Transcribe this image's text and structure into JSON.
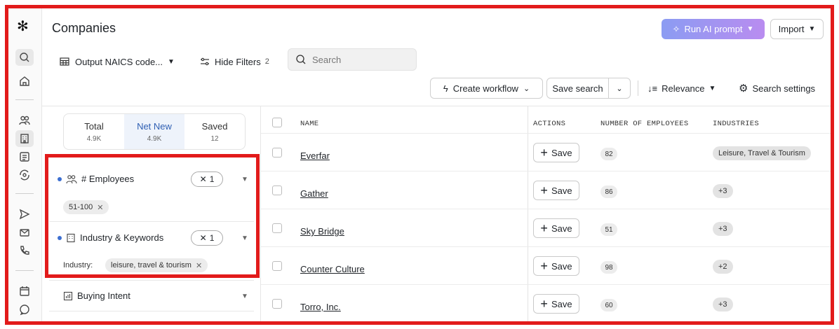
{
  "header": {
    "title": "Companies",
    "ai_button": "Run AI prompt",
    "import_button": "Import"
  },
  "toolbar": {
    "output_label": "Output NAICS code...",
    "hide_filters_label": "Hide Filters",
    "hide_filters_count": "2",
    "search_placeholder": "Search",
    "create_workflow": "Create workflow",
    "save_search": "Save search",
    "relevance": "Relevance",
    "search_settings": "Search settings"
  },
  "segments": [
    {
      "label": "Total",
      "count": "4.9K"
    },
    {
      "label": "Net New",
      "count": "4.9K"
    },
    {
      "label": "Saved",
      "count": "12"
    }
  ],
  "filters": {
    "employees": {
      "title": "# Employees",
      "count": "1",
      "chip": "51-100"
    },
    "industry": {
      "title": "Industry & Keywords",
      "count": "1",
      "sub_label": "Industry:",
      "chip": "leisure, travel & tourism"
    },
    "buying": {
      "title": "Buying Intent"
    }
  },
  "table": {
    "headers": {
      "name": "NAME",
      "actions": "ACTIONS",
      "employees": "NUMBER OF EMPLOYEES",
      "industries": "INDUSTRIES"
    },
    "save_label": "Save",
    "rows": [
      {
        "name": "Everfar",
        "employees": "82",
        "industry": "Leisure, Travel & Tourism"
      },
      {
        "name": "Gather",
        "employees": "86",
        "industry": "+3"
      },
      {
        "name": "Sky Bridge",
        "employees": "51",
        "industry": "+3"
      },
      {
        "name": "Counter Culture",
        "employees": "98",
        "industry": "+2"
      },
      {
        "name": "Torro, Inc.",
        "employees": "60",
        "industry": "+3"
      }
    ]
  },
  "colors": {
    "accent": "#3c6fd1",
    "ai_gradient_start": "#8b9cf2",
    "ai_gradient_end": "#b98cf0",
    "highlight": "#e21b1b"
  }
}
